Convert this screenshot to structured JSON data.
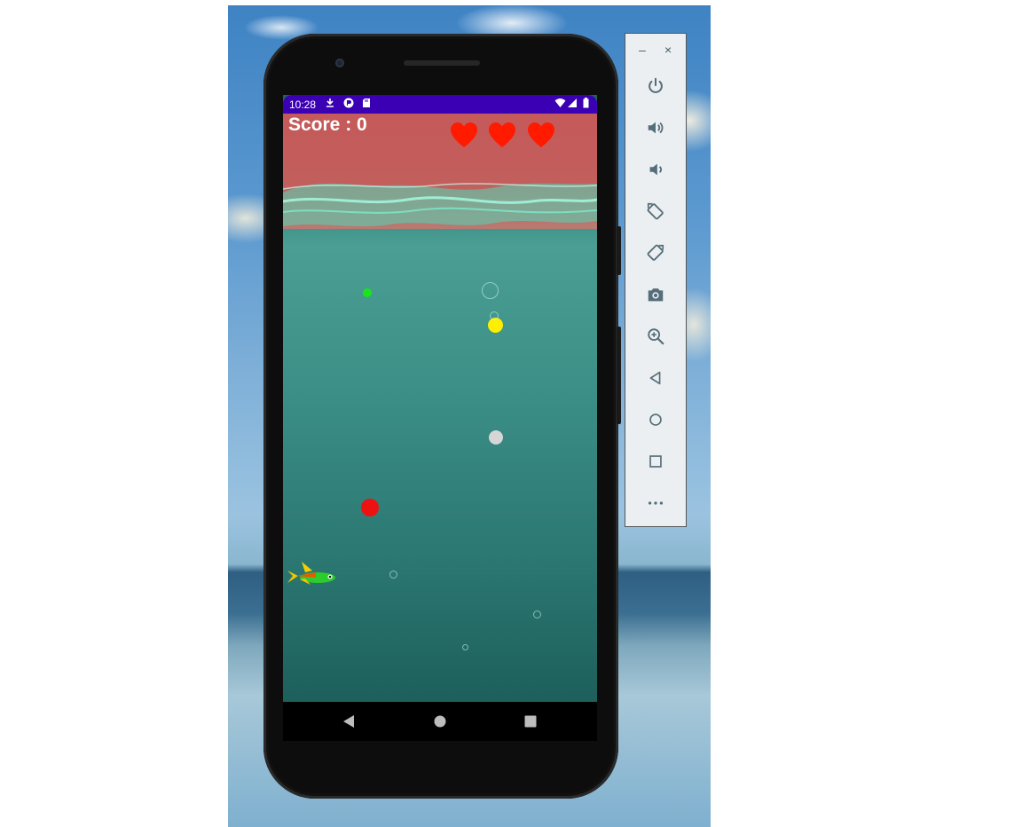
{
  "device": {
    "status_bar": {
      "time": "10:28"
    },
    "game": {
      "score_text": "Score : 0",
      "lives": 3,
      "colors": {
        "sky": "#c45a5a",
        "sea": "#2d7f7a",
        "heart": "#ff1a00",
        "status_bar": "#3b00b3"
      }
    }
  },
  "emulator_toolbar": {
    "window_controls": {
      "minimize": "–",
      "close": "×"
    },
    "buttons": [
      {
        "name": "power-icon"
      },
      {
        "name": "volume-up-icon"
      },
      {
        "name": "volume-down-icon"
      },
      {
        "name": "rotate-left-icon"
      },
      {
        "name": "rotate-right-icon"
      },
      {
        "name": "camera-icon"
      },
      {
        "name": "zoom-icon"
      },
      {
        "name": "back-icon"
      },
      {
        "name": "home-icon"
      },
      {
        "name": "overview-icon"
      },
      {
        "name": "more-icon"
      }
    ]
  }
}
